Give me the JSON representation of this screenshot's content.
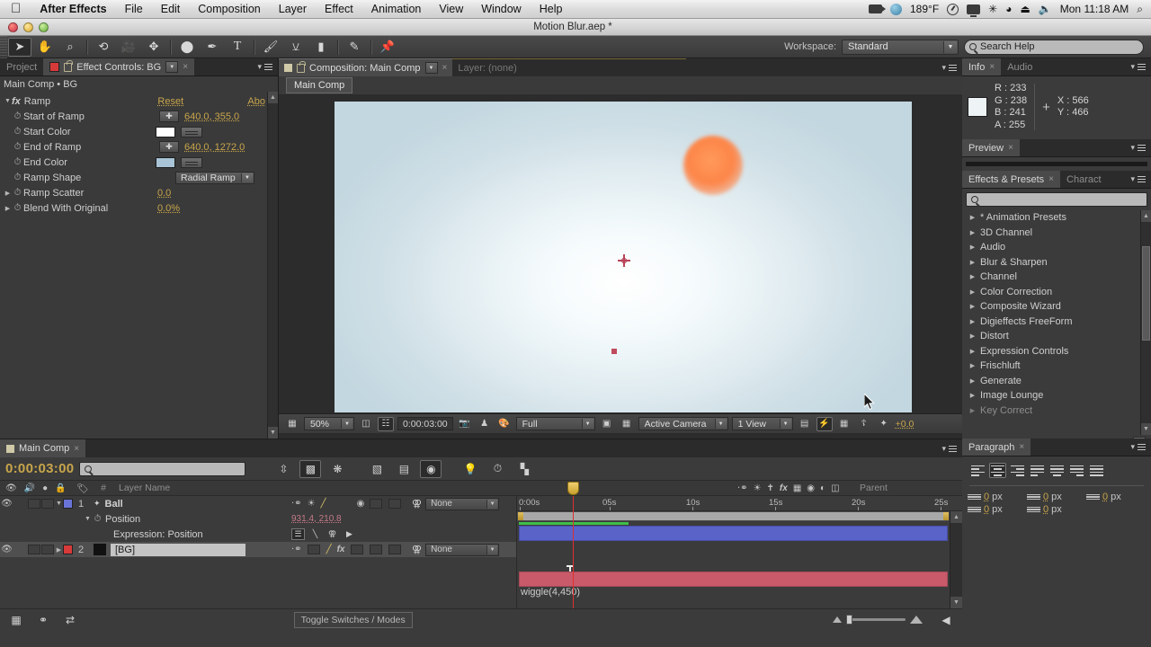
{
  "macbar": {
    "apple_icon": "apple-icon",
    "app_name": "After Effects",
    "menus": [
      "File",
      "Edit",
      "Composition",
      "Layer",
      "Effect",
      "Animation",
      "View",
      "Window",
      "Help"
    ],
    "status": {
      "temperature": "189°F",
      "clock": "Mon 11:18 AM",
      "icons": [
        "video-camera-icon",
        "globe-icon",
        "compass-icon",
        "display-icon",
        "bluetooth-icon",
        "wifi-icon",
        "eject-icon",
        "volume-icon",
        "spotlight-search-icon"
      ],
      "bluetooth_glyph": "✳",
      "wifi_glyph": "◗",
      "eject_glyph": "⏏",
      "volume_glyph": "🔈",
      "spotlight_glyph": "⌕"
    }
  },
  "window": {
    "title": "Motion Blur.aep *"
  },
  "toolbar": {
    "tools": [
      {
        "name": "selection-tool",
        "glyph": "➤",
        "active": true
      },
      {
        "name": "hand-tool",
        "glyph": "✋",
        "active": false
      },
      {
        "name": "zoom-tool",
        "glyph": "⌕",
        "active": false
      },
      {
        "name": "rotation-tool",
        "glyph": "⟳",
        "active": false
      },
      {
        "name": "camera-tool",
        "glyph": "🎥",
        "active": false
      },
      {
        "name": "pan-behind-tool",
        "glyph": "✥",
        "active": false
      },
      {
        "name": "shape-tool",
        "glyph": "⬬",
        "active": false
      },
      {
        "name": "pen-tool",
        "glyph": "✒",
        "active": false
      },
      {
        "name": "text-tool",
        "glyph": "T",
        "active": false
      },
      {
        "name": "brush-tool",
        "glyph": "🖌",
        "active": false
      },
      {
        "name": "clone-stamp-tool",
        "glyph": "⚲",
        "active": false
      },
      {
        "name": "eraser-tool",
        "glyph": "▰",
        "active": false
      },
      {
        "name": "roto-brush-tool",
        "glyph": "✎",
        "active": false
      },
      {
        "name": "puppet-pin-tool",
        "glyph": "📌",
        "active": false
      }
    ],
    "workspace_label": "Workspace:",
    "workspace_value": "Standard",
    "search_help_placeholder": "Search Help"
  },
  "effect_controls": {
    "tabs": [
      {
        "label": "Project",
        "active": false
      },
      {
        "label": "Effect Controls: BG",
        "active": true
      }
    ],
    "header": "Main Comp • BG",
    "effect_name": "Ramp",
    "reset_label": "Reset",
    "about_label": "Abo",
    "properties": [
      {
        "name": "Start of Ramp",
        "value": "640.0, 355.0",
        "type": "point"
      },
      {
        "name": "Start Color",
        "value": "",
        "type": "color",
        "color": "#ffffff"
      },
      {
        "name": "End of Ramp",
        "value": "640.0, 1272.0",
        "type": "point"
      },
      {
        "name": "End Color",
        "value": "",
        "type": "color",
        "color": "#a8c4d6"
      },
      {
        "name": "Ramp Shape",
        "value": "Radial Ramp",
        "type": "dropdown"
      },
      {
        "name": "Ramp Scatter",
        "value": "0.0",
        "type": "number",
        "expandable": true
      },
      {
        "name": "Blend With Original",
        "value": "0.0%",
        "type": "number",
        "expandable": true
      }
    ]
  },
  "composition": {
    "tabs": [
      {
        "label": "Composition: Main Comp",
        "active": true
      },
      {
        "label": "Layer: (none)",
        "active": false
      }
    ],
    "breadcrumb": "Main Comp",
    "viewer_bar": {
      "zoom": "50%",
      "time": "0:00:03:00",
      "resolution": "Full",
      "camera": "Active Camera",
      "views": "1 View",
      "exposure": "+0.0",
      "snapshot_icon": "camera-icon",
      "show_snapshot_icon": "person-icon",
      "channels_icon": "channels-icon",
      "region_icon": "region-of-interest-icon",
      "transparency_icon": "transparency-grid-icon",
      "guides_icon": "guides-icon",
      "fast_preview_icon": "fast-preview-icon",
      "timeline_icon": "timeline-icon",
      "flowchart_icon": "flowchart-icon",
      "exposure_icon": "exposure-icon"
    }
  },
  "info": {
    "tabs": [
      {
        "label": "Info",
        "active": true
      },
      {
        "label": "Audio",
        "active": false
      }
    ],
    "r_label": "R :",
    "r_value": "233",
    "g_label": "G :",
    "g_value": "238",
    "b_label": "B :",
    "b_value": "241",
    "a_label": "A :",
    "a_value": "255",
    "x_label": "X :",
    "x_value": "566",
    "y_label": "Y :",
    "y_value": "466",
    "swatch_color": "#e9eef1"
  },
  "preview": {
    "tabs": [
      {
        "label": "Preview",
        "active": true
      }
    ]
  },
  "effects_presets": {
    "tabs": [
      {
        "label": "Effects & Presets",
        "active": true
      },
      {
        "label": "Charact",
        "active": false
      }
    ],
    "search_placeholder": "",
    "items": [
      "* Animation Presets",
      "3D Channel",
      "Audio",
      "Blur & Sharpen",
      "Channel",
      "Color Correction",
      "Composite Wizard",
      "Digieffects FreeForm",
      "Distort",
      "Expression Controls",
      "Frischluft",
      "Generate",
      "Image Lounge",
      "Key Correct"
    ]
  },
  "paragraph": {
    "tabs": [
      {
        "label": "Paragraph",
        "active": true
      }
    ],
    "align_buttons": [
      {
        "name": "align-left",
        "selected": false
      },
      {
        "name": "align-center",
        "selected": true
      },
      {
        "name": "align-right",
        "selected": false
      },
      {
        "name": "justify-last-left",
        "selected": false
      },
      {
        "name": "justify-last-center",
        "selected": false
      },
      {
        "name": "justify-last-right",
        "selected": false
      },
      {
        "name": "justify-all",
        "selected": false
      }
    ],
    "fields": [
      {
        "name": "indent-left",
        "value": "0",
        "unit": "px"
      },
      {
        "name": "indent-right",
        "value": "0",
        "unit": "px"
      },
      {
        "name": "indent-first-line",
        "value": "0",
        "unit": "px"
      },
      {
        "name": "space-before",
        "value": "0",
        "unit": "px"
      },
      {
        "name": "space-after",
        "value": "0",
        "unit": "px"
      }
    ]
  },
  "timeline": {
    "tabs": [
      {
        "label": "Main Comp",
        "active": true
      }
    ],
    "current_time": "0:00:03:00",
    "search_placeholder": "",
    "tool_buttons": [
      {
        "name": "composition-mini-flowchart",
        "glyph": "⇹",
        "pressed": false
      },
      {
        "name": "draft-3d",
        "glyph": "⊡",
        "pressed": true
      },
      {
        "name": "hide-shy-layers",
        "glyph": "❃",
        "pressed": false
      },
      {
        "name": "frame-blending",
        "glyph": "▤",
        "pressed": false
      },
      {
        "name": "motion-blur",
        "glyph": "◍",
        "pressed": true
      },
      {
        "name": "brainstorm",
        "glyph": "💡",
        "pressed": false
      },
      {
        "name": "auto-keyframe",
        "glyph": "⏱",
        "pressed": false
      },
      {
        "name": "graph-editor",
        "glyph": "📈",
        "pressed": false
      }
    ],
    "columns": {
      "layer_name": "Layer Name",
      "parent": "Parent",
      "av_icons": [
        "eye-icon",
        "audio-icon",
        "solo-icon",
        "lock-icon"
      ],
      "switch_icons": [
        "shy-icon",
        "collapse-icon",
        "quality-icon",
        "effects-icon",
        "frame-blend-icon",
        "motion-blur-icon",
        "adjustment-icon",
        "3d-layer-icon"
      ]
    },
    "layers": [
      {
        "index": "1",
        "name": "Ball",
        "color": "#6a74d8",
        "selected": false,
        "parent": "None",
        "bar_color": "#5a63c8",
        "properties": [
          {
            "name": "Position",
            "value": "931.4, 210.8"
          },
          {
            "name": "Expression: Position",
            "value": "wiggle(4,450)"
          }
        ]
      },
      {
        "index": "2",
        "name": "[BG]",
        "color": "#d83a3a",
        "selected": true,
        "parent": "None",
        "bar_color": "#c85a6a"
      }
    ],
    "ruler_ticks": [
      "0:00s",
      "05s",
      "10s",
      "15s",
      "20s",
      "25s"
    ],
    "footer": {
      "toggle_label": "Toggle Switches / Modes",
      "icons": [
        "comp-settings-icon",
        "layer-switches-icon",
        "transfer-controls-icon"
      ]
    }
  }
}
